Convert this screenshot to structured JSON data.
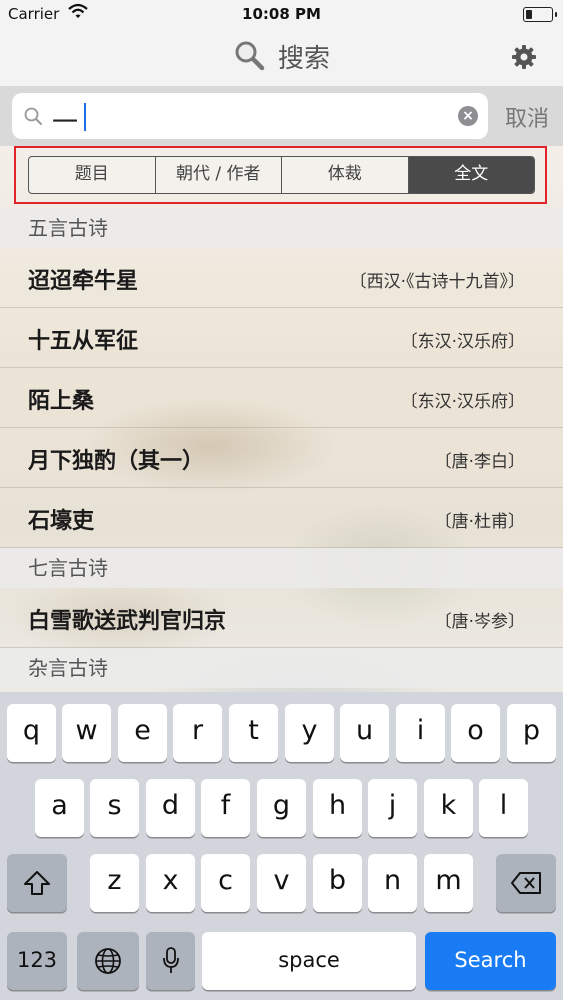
{
  "status_bar": {
    "carrier": "Carrier",
    "time": "10:08 PM"
  },
  "navbar": {
    "title": "搜索",
    "settings_icon": "gear-icon"
  },
  "search": {
    "value": "一",
    "cancel": "取消"
  },
  "segments": [
    {
      "label": "题目",
      "active": false
    },
    {
      "label": "朝代 / 作者",
      "active": false
    },
    {
      "label": "体裁",
      "active": false
    },
    {
      "label": "全文",
      "active": true
    }
  ],
  "results": [
    {
      "header": "五言古诗"
    },
    {
      "title": "迢迢牵牛星",
      "author": "〔西汉·《古诗十九首》〕"
    },
    {
      "title": "十五从军征",
      "author": "〔东汉·汉乐府〕"
    },
    {
      "title": "陌上桑",
      "author": "〔东汉·汉乐府〕"
    },
    {
      "title": "月下独酌（其一）",
      "author": "〔唐·李白〕"
    },
    {
      "title": "石壕吏",
      "author": "〔唐·杜甫〕"
    },
    {
      "header": "七言古诗"
    },
    {
      "title": "白雪歌送武判官归京",
      "author": "〔唐·岑参〕"
    },
    {
      "header": "杂言古诗"
    }
  ],
  "keyboard": {
    "row1": [
      "q",
      "w",
      "e",
      "r",
      "t",
      "y",
      "u",
      "i",
      "o",
      "p"
    ],
    "row2": [
      "a",
      "s",
      "d",
      "f",
      "g",
      "h",
      "j",
      "k",
      "l"
    ],
    "row3": [
      "z",
      "x",
      "c",
      "v",
      "b",
      "n",
      "m"
    ],
    "numbers_key": "123",
    "space_key": "space",
    "search_key": "Search"
  },
  "colors": {
    "accent": "#1a7cf5",
    "highlight_border": "#e0242a",
    "active_segment": "#4a4a4a"
  }
}
